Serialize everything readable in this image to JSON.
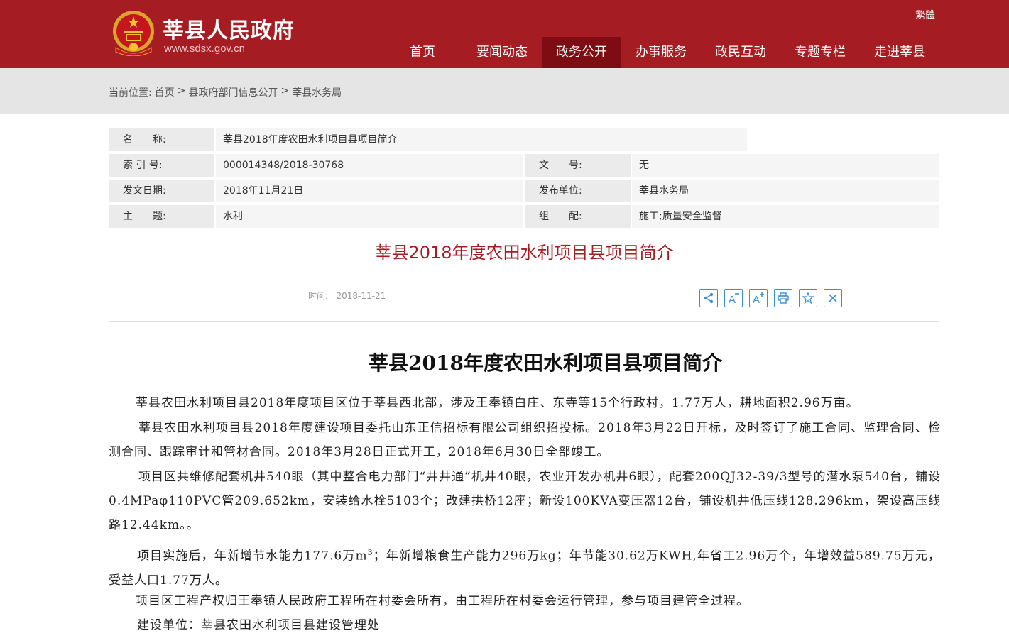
{
  "header": {
    "title": "莘县人民政府",
    "url": "www.sdsx.gov.cn",
    "traditional": "繁體",
    "nav": [
      "首页",
      "要闻动态",
      "政务公开",
      "办事服务",
      "政民互动",
      "专题专栏",
      "走进莘县"
    ],
    "active_nav": "政务公开",
    "colors": {
      "brand": "#a51c22",
      "active": "#7d0d12"
    }
  },
  "breadcrumb": {
    "label": "当前位置:",
    "items": [
      "首页",
      "县政府部门信息公开",
      "莘县水务局"
    ],
    "sep": ">"
  },
  "info": {
    "name_label": "名　　称:",
    "name_value": "莘县2018年度农田水利项目县项目简介",
    "index_label": "索 引 号:",
    "index_value": "000014348/2018-30768",
    "doc_label": "文　　号:",
    "doc_value": "无",
    "date_label": "发文日期:",
    "date_value": "2018年11月21日",
    "org_label": "发布单位:",
    "org_value": "莘县水务局",
    "topic_label": "主　　题:",
    "topic_value": "水利",
    "group_label": "组　　配:",
    "group_value": "施工;质量安全监督"
  },
  "doc": {
    "heading": "莘县2018年度农田水利项目县项目简介",
    "time_label": "时间:",
    "time_value": "2018-11-21",
    "tools": [
      "share-icon",
      "font-decrease-icon",
      "font-increase-icon",
      "print-icon",
      "favorite-icon",
      "close-icon"
    ]
  },
  "article": {
    "title": "莘县2018年度农田水利项目县项目简介",
    "p1": "莘县农田水利项目县2018年度项目区位于莘县西北部，涉及王奉镇白庄、东寺等15个行政村，1.77万人，耕地面积2.96万亩。",
    "p2": "莘县农田水利项目县2018年度建设项目委托山东正信招标有限公司组织招投标。2018年3月22日开标，及时签订了施工合同、监理合同、检测合同、跟踪审计和管材合同。2018年3月28日正式开工，2018年6月30日全部竣工。",
    "p3": "项目区共维修配套机井540眼（其中整合电力部门“井井通”机井40眼，农业开发办机井6眼），配套200QJ32-39/3型号的潜水泵540台，铺设0.4MPaφ110PVC管209.652km，安装给水栓5103个；改建拱桥12座；新设100KVA变压器12台，铺设机井低压线128.296km，架设高压线路12.44km。。",
    "p4a": "项目实施后，年新增节水能力177.6万m",
    "p4sup": "3",
    "p4b": "；年新增粮食生产能力296万kg；年节能30.62万KWH,年省工2.96万个，年增效益589.75万元，受益人口1.77万人。",
    "p5": "项目区工程产权归王奉镇人民政府工程所在村委会所有，由工程所在村委会运行管理，参与项目建管全过程。",
    "p6": "建设单位：莘县农田水利项目县建设管理处"
  }
}
